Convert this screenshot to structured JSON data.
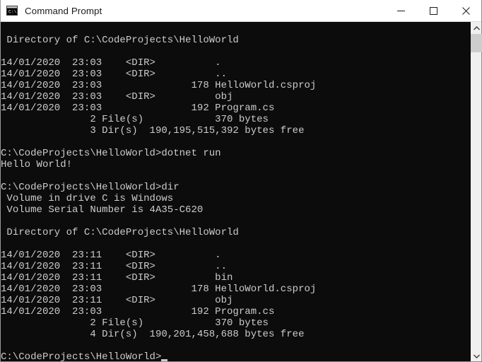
{
  "window": {
    "title": "Command Prompt",
    "icon": "console-icon",
    "background_color": "#0c0c0c",
    "text_color": "#cccccc",
    "titlebar_color": "#ffffff",
    "controls": [
      {
        "name": "minimize",
        "glyph": "minimize-icon",
        "label": "Minimize"
      },
      {
        "name": "maximize",
        "glyph": "maximize-icon",
        "label": "Maximize"
      },
      {
        "name": "close",
        "glyph": "close-icon",
        "label": "Close"
      }
    ]
  },
  "scrollbar": {
    "up_arrow": "chevron-up-icon",
    "down_arrow": "chevron-down-icon",
    "thumb_color": "#cdcdcd",
    "track_color": "#f0f0f0"
  },
  "terminal": {
    "lines": [
      "",
      " Directory of C:\\CodeProjects\\HelloWorld",
      "",
      "14/01/2020  23:03    <DIR>          .",
      "14/01/2020  23:03    <DIR>          ..",
      "14/01/2020  23:03               178 HelloWorld.csproj",
      "14/01/2020  23:03    <DIR>          obj",
      "14/01/2020  23:03               192 Program.cs",
      "               2 File(s)            370 bytes",
      "               3 Dir(s)  190,195,515,392 bytes free",
      "",
      "C:\\CodeProjects\\HelloWorld>dotnet run",
      "Hello World!",
      "",
      "C:\\CodeProjects\\HelloWorld>dir",
      " Volume in drive C is Windows",
      " Volume Serial Number is 4A35-C620",
      "",
      " Directory of C:\\CodeProjects\\HelloWorld",
      "",
      "14/01/2020  23:11    <DIR>          .",
      "14/01/2020  23:11    <DIR>          ..",
      "14/01/2020  23:11    <DIR>          bin",
      "14/01/2020  23:03               178 HelloWorld.csproj",
      "14/01/2020  23:11    <DIR>          obj",
      "14/01/2020  23:03               192 Program.cs",
      "               2 File(s)            370 bytes",
      "               4 Dir(s)  190,201,458,688 bytes free",
      ""
    ],
    "prompt": "C:\\CodeProjects\\HelloWorld>",
    "cursor": "_"
  }
}
